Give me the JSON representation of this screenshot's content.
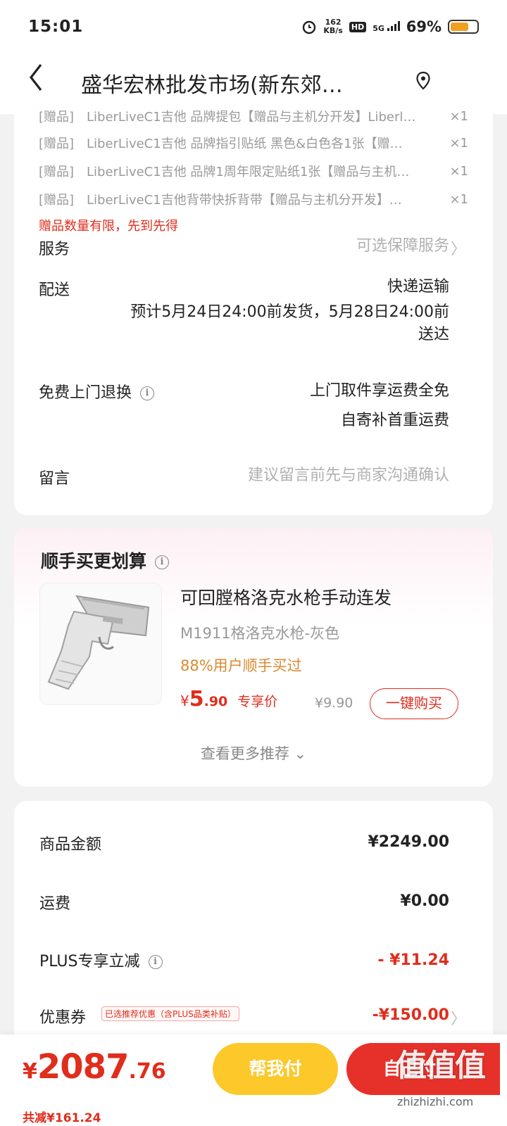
{
  "status_bar": {
    "time": "15:01",
    "speed_value": "162",
    "speed_unit": "KB/s",
    "hd": "HD",
    "network": "5G",
    "battery_text": "69%",
    "battery_level": 0.69
  },
  "header": {
    "back_icon": "chevron-left-icon",
    "title": "盛华宏林批发市场(新东郊…",
    "location_icon": "location-pin-icon"
  },
  "gifts": {
    "items": [
      {
        "tag": "[赠品]",
        "name": "LiberLiveC1吉他 品牌提包【赠品与主机分开发】Liberl…",
        "qty": "×1"
      },
      {
        "tag": "[赠品]",
        "name": "LiberLiveC1吉他 品牌指引贴纸 黑色&白色各1张【赠…",
        "qty": "×1"
      },
      {
        "tag": "[赠品]",
        "name": "LiberLiveC1吉他 品牌1周年限定贴纸1张【赠品与主机…",
        "qty": "×1"
      },
      {
        "tag": "[赠品]",
        "name": "LiberLiveC1吉他背带快拆背带【赠品与主机分开发】…",
        "qty": "×1"
      }
    ],
    "note": "赠品数量有限，先到先得"
  },
  "service": {
    "label": "服务",
    "value": "可选保障服务"
  },
  "delivery": {
    "label": "配送",
    "method": "快递运输",
    "estimate_line1": "预计5月24日24:00前发货，5月28日24:00前",
    "estimate_line2": "送达"
  },
  "return": {
    "label": "免费上门退换",
    "line1": "上门取件享运费全免",
    "line2": "自寄补首重运费"
  },
  "message": {
    "label": "留言",
    "placeholder": "建议留言前先与商家沟通确认"
  },
  "recommend": {
    "heading": "顺手买更划算",
    "product": {
      "title": "可回膛格洛克水枪手动连发",
      "spec": "M1911格洛克水枪-灰色",
      "buyers": "88%用户顺手买过",
      "price_currency": "¥",
      "price_int": "5",
      "price_dec": ".90",
      "price_tag": "专享价",
      "original_price": "¥9.90",
      "buy_button": "一键购买"
    },
    "more": "查看更多推荐 ⌄"
  },
  "summary": {
    "goods_label": "商品金额",
    "goods_value": "¥2249.00",
    "shipping_label": "运费",
    "shipping_value": "¥0.00",
    "plus_label": "PLUS专享立减",
    "plus_value": "- ¥11.24",
    "coupon_label": "优惠券",
    "coupon_badge": "已选推荐优惠（含PLUS品类补贴）",
    "coupon_value": "-¥150.00"
  },
  "bottom": {
    "total_currency": "¥",
    "total_int": "2087",
    "total_dec": ".76",
    "saved": "共减¥161.24",
    "help_pay": "帮我付",
    "self_pay": "自己付"
  },
  "watermark": {
    "big": "值值值",
    "small": "zhizhizhi.com"
  },
  "colors": {
    "accent_red": "#e02d1c",
    "help_pay_yellow": "#fcc82a",
    "buyers_orange": "#d9892f"
  }
}
